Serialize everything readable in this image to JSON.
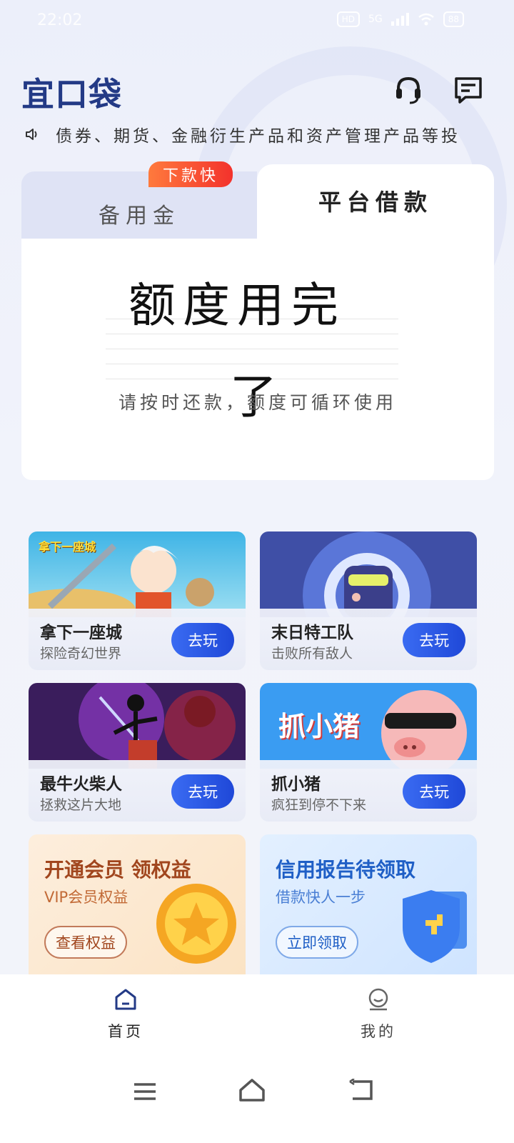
{
  "status_bar": {
    "time": "22:02",
    "network": "5G",
    "hd": "HD",
    "battery": "88"
  },
  "header": {
    "logo": "宜口袋"
  },
  "notice": {
    "text": "债券、期货、金融衍生产品和资产管理产品等投"
  },
  "loan_tabs": {
    "left_label": "备用金",
    "left_badge": "下款快",
    "right_label": "平台借款",
    "title_line1": "额度用完",
    "title_line2": "了",
    "subtitle": "请按时还款，额度可循环使用"
  },
  "games": [
    {
      "title": "拿下一座城",
      "desc": "探险奇幻世界",
      "button": "去玩",
      "art_text": "拿下一座城"
    },
    {
      "title": "末日特工队",
      "desc": "击败所有敌人",
      "button": "去玩"
    },
    {
      "title": "最牛火柴人",
      "desc": "拯救这片大地",
      "button": "去玩"
    },
    {
      "title": "抓小猪",
      "desc": "疯狂到停不下来",
      "button": "去玩",
      "art_text": "抓小猪"
    }
  ],
  "promos": [
    {
      "title": "开通会员 领权益",
      "sub": "VIP会员权益",
      "button": "查看权益"
    },
    {
      "title": "信用报告待领取",
      "sub": "借款快人一步",
      "button": "立即领取"
    }
  ],
  "bottom_nav": [
    {
      "label": "首页",
      "icon": "home-icon"
    },
    {
      "label": "我的",
      "icon": "profile-icon"
    }
  ],
  "colors": {
    "brand": "#233a86",
    "button_blue": "#2a56e4",
    "badge_red": "#f3322c"
  }
}
